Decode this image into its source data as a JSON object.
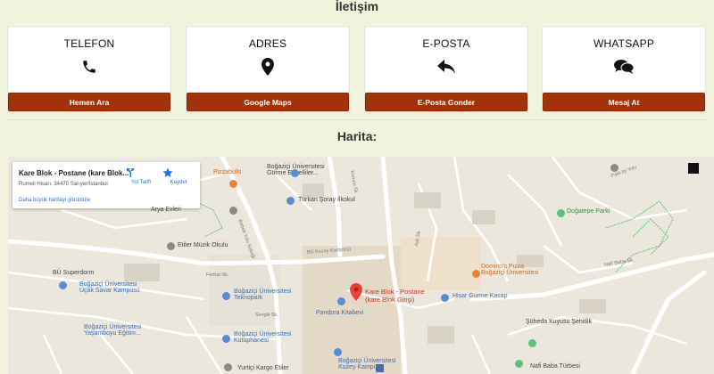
{
  "contact_title": "İletişim",
  "map_title": "Harita:",
  "cards": [
    {
      "title": "TELEFON",
      "icon": "phone-icon",
      "button": "Hemen Ara"
    },
    {
      "title": "ADRES",
      "icon": "map-marker-icon",
      "button": "Google Maps"
    },
    {
      "title": "E-POSTA",
      "icon": "reply-icon",
      "button": "E-Posta Gonder"
    },
    {
      "title": "WHATSAPP",
      "icon": "chat-bubbles-icon",
      "button": "Mesaj At"
    }
  ],
  "colors": {
    "background": "#f2f3dc",
    "button": "#a3320b",
    "map_pin": "#ea4335"
  },
  "map": {
    "place_name": "Kare Blok - Postane (kare Blok...",
    "place_address": "Rumeli Hisarı, 34470 Sarıyer/İstanbul",
    "larger_map_link": "Daha büyük haritayı görüntüle",
    "directions_label": "Yol Tarifi",
    "save_label": "Kaydet",
    "pin_label": "Kare Blok - Postane\n(kare Blok Girişi)",
    "labels": {
      "boun_gorme": "Boğaziçi Üniversitesi\nGörme Engelliler...",
      "turkan": "Türkan Şoray İlkokul",
      "pizzabulls": "Pizzabulls",
      "arya": "Arya Evleri",
      "etiler_muzik": "Etiler Müzik Okulu",
      "bu_superdorm": "BÜ Superdorm",
      "boun_ucak": "Boğaziçi Üniversitesi\nUçak Savar Kampüsü",
      "boun_yasamboyu": "Boğaziçi Üniversitesi\nYaşamboyu Eğitim...",
      "boun_tekno": "Boğaziçi Üniversitesi\nTeknopark",
      "pandora": "Pandora Kitabevi",
      "boun_kutup": "Boğaziçi Üniversitesi\nKütüphanesi",
      "yurtici": "Yurtiçi Kargo Etiler",
      "boun_kuzey": "Boğaziçi Üniversitesi\nKuzey Kampüsü",
      "dominos": "Domino's Pizza\nBoğaziçi Üniversitesi",
      "hisar_gurme": "Hisar Gurme Kasap",
      "doğatepe": "Doğatepe Parkı",
      "suheda": "Şüheda Kuyusu Şehitlik",
      "nafi_turbe": "Nafi Baba Türbesi"
    },
    "streets": {
      "bebek": "Bebek Yolu Sokağı",
      "kuzey": "BÜ Kuzey Kampüsü",
      "feribat": "Ferhat Sk.",
      "sevgili": "Sevgili Sk.",
      "nafi": "Nafi Baba Sk.",
      "park": "Park Içi Yolu",
      "asli": "Aslı Sk.",
      "kurucu": "Kurucu Sk."
    }
  }
}
